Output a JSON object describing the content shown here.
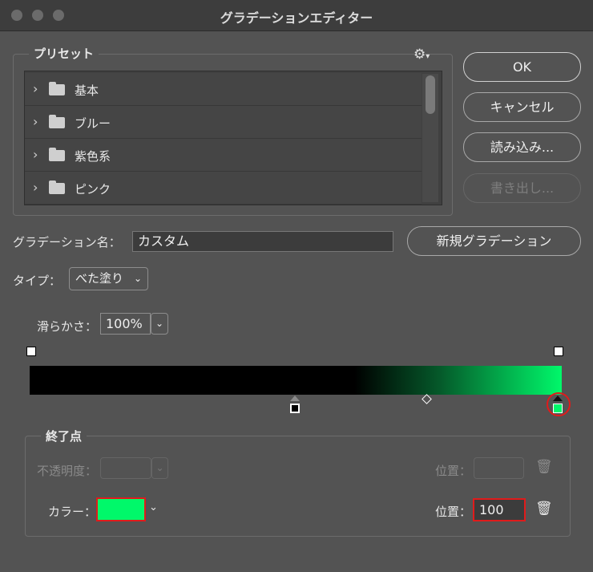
{
  "window": {
    "title": "グラデーションエディター"
  },
  "presets": {
    "legend": "プリセット",
    "items": [
      {
        "label": "基本"
      },
      {
        "label": "ブルー"
      },
      {
        "label": "紫色系"
      },
      {
        "label": "ピンク"
      }
    ]
  },
  "buttons": {
    "ok": "OK",
    "cancel": "キャンセル",
    "load": "読み込み...",
    "export": "書き出し...",
    "new_gradient": "新規グラデーション"
  },
  "gradient_name": {
    "label": "グラデーション名：",
    "value": "カスタム"
  },
  "type": {
    "label": "タイプ：",
    "value": "べた塗り"
  },
  "smoothness": {
    "label": "滑らかさ：",
    "value": "100%"
  },
  "gradient": {
    "start_color": "#000000",
    "end_color": "#00f86a",
    "midpoint": 0.75
  },
  "stops": {
    "legend": "終了点",
    "opacity_label": "不透明度：",
    "opacity_value": "",
    "opacity_location_label": "位置：",
    "opacity_location_value": "",
    "color_label": "カラー：",
    "color_value": "#00f86a",
    "color_location_label": "位置：",
    "color_location_value": "100"
  },
  "icons": {
    "gear": "gear-icon",
    "trash": "trash-icon",
    "chevron": "chevron-down-icon",
    "folder": "folder-icon"
  },
  "highlight_color": "#e01b1b"
}
